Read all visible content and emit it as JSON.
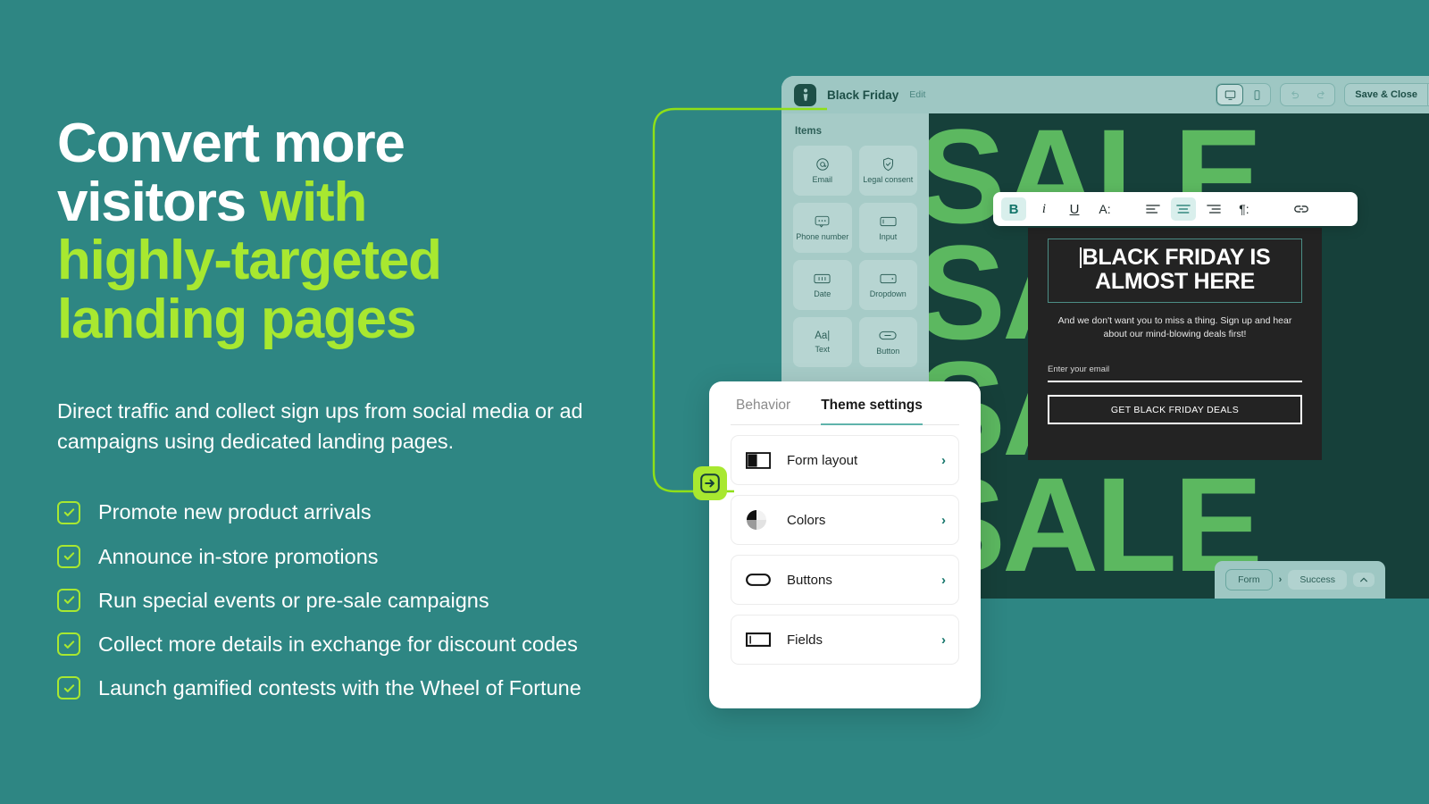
{
  "colors": {
    "background_teal": "#2e8683",
    "accent_green": "#a8e830",
    "canvas_dark": "#16403a",
    "sale_green": "#5cb860",
    "popup_black": "#232323",
    "panel_teal": "#9ec7c3",
    "tab_underline": "#5fb3ab"
  },
  "marketing": {
    "headline": {
      "line1_white": "Convert more",
      "line2_white": "visitors ",
      "line2_accent": "with",
      "line3_accent": "highly-targeted",
      "line4_accent": "landing pages"
    },
    "subcopy": "Direct traffic and collect sign ups from social media or ad campaigns using dedicated landing pages.",
    "bullets": [
      {
        "label": "Promote new product arrivals"
      },
      {
        "label": "Announce in-store promotions"
      },
      {
        "label": "Run special events or pre-sale campaigns"
      },
      {
        "label": "Collect more details in exchange for discount codes"
      },
      {
        "label": "Launch gamified contests with the Wheel of Fortune"
      }
    ]
  },
  "app": {
    "topbar": {
      "logo_icon": "brand-logo-icon",
      "title": "Black Friday",
      "edit_label": "Edit",
      "device_desktop_icon": "desktop-icon",
      "device_mobile_icon": "mobile-icon",
      "undo_icon": "undo-icon",
      "redo_icon": "redo-icon",
      "save_label": "Save & Close",
      "save_caret_icon": "chevron-down-icon"
    },
    "items_panel": {
      "title": "Items",
      "items": [
        {
          "label": "Email",
          "icon": "at-sign-icon"
        },
        {
          "label": "Legal consent",
          "icon": "shield-check-icon"
        },
        {
          "label": "Phone number",
          "icon": "message-dots-icon"
        },
        {
          "label": "Input",
          "icon": "input-field-icon"
        },
        {
          "label": "Date",
          "icon": "date-field-icon"
        },
        {
          "label": "Dropdown",
          "icon": "dropdown-icon"
        },
        {
          "label": "Text",
          "icon": "text-cursor-icon"
        },
        {
          "label": "Button",
          "icon": "button-pill-icon"
        }
      ]
    },
    "canvas": {
      "background_word": "SALE",
      "lines": [
        "SALE",
        "SALE",
        "SALE",
        "SALE"
      ]
    },
    "bottom_bar": {
      "step_form": "Form",
      "separator": "›",
      "step_success": "Success",
      "caret_icon": "chevron-up-icon"
    }
  },
  "format_toolbar": {
    "buttons": [
      {
        "name": "bold",
        "glyph": "B",
        "active": true
      },
      {
        "name": "italic",
        "glyph": "i",
        "active": false
      },
      {
        "name": "underline",
        "glyph": "U",
        "active": false
      },
      {
        "name": "font-size",
        "glyph": "A:",
        "active": false
      },
      {
        "name": "align-left",
        "glyph": "align-left-icon",
        "active": false
      },
      {
        "name": "align-center",
        "glyph": "align-center-icon",
        "active": true
      },
      {
        "name": "align-right",
        "glyph": "align-right-icon",
        "active": false
      },
      {
        "name": "paragraph",
        "glyph": "¶:",
        "active": false
      },
      {
        "name": "link",
        "glyph": "link-icon",
        "active": false
      }
    ]
  },
  "popup": {
    "heading": "BLACK FRIDAY IS ALMOST HERE",
    "subtext": "And we don't want you to miss a thing. Sign up and hear about our mind-blowing deals first!",
    "email_placeholder": "Enter your email",
    "cta_label": "GET BLACK FRIDAY DEALS"
  },
  "settings_card": {
    "tabs": [
      {
        "label": "Behavior",
        "active": false
      },
      {
        "label": "Theme settings",
        "active": true
      }
    ],
    "rows": [
      {
        "label": "Form layout",
        "icon": "form-layout-icon",
        "caret": "›"
      },
      {
        "label": "Colors",
        "icon": "color-wheel-icon",
        "caret": "›"
      },
      {
        "label": "Buttons",
        "icon": "button-pill-icon",
        "caret": "›"
      },
      {
        "label": "Fields",
        "icon": "text-field-icon",
        "caret": "›"
      }
    ]
  },
  "callout": {
    "arrow_badge_icon": "arrow-right-boxed-icon"
  }
}
